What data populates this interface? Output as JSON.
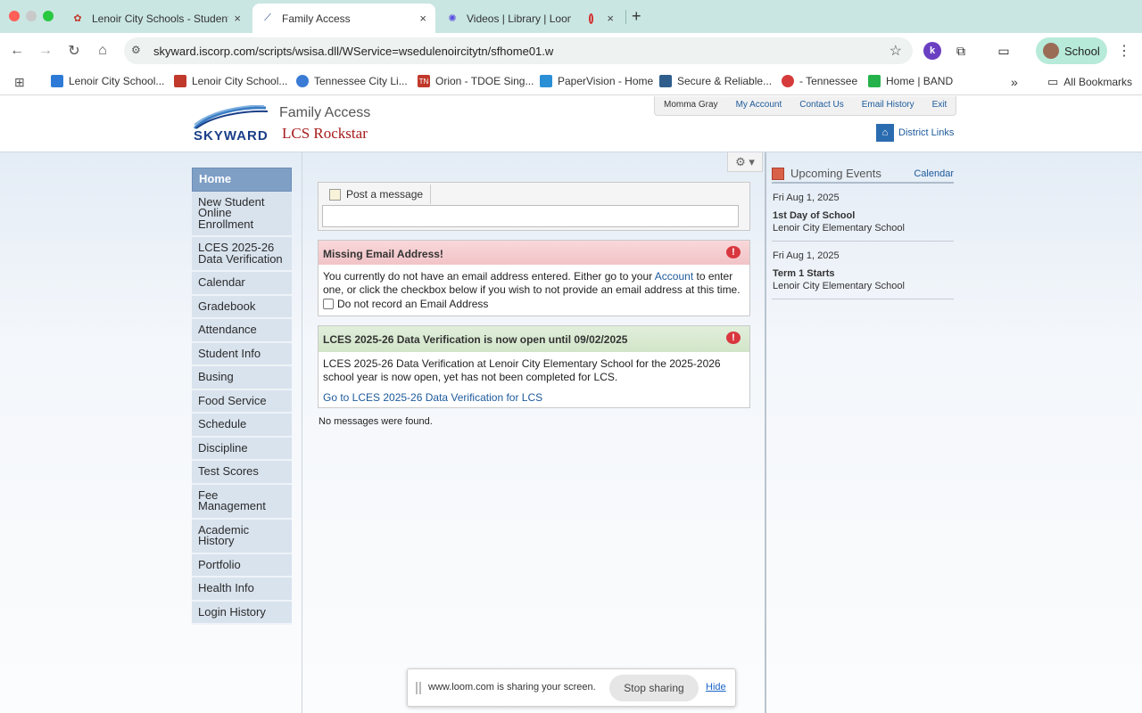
{
  "browser": {
    "tabs": [
      {
        "label": "Lenoir City Schools - Student",
        "active": false,
        "icon": "school-favicon-icon"
      },
      {
        "label": "Family Access",
        "active": true,
        "icon": "skyward-favicon-icon"
      },
      {
        "label": "Videos | Library | Loom",
        "active": false,
        "icon": "loom-favicon-icon"
      }
    ],
    "close_glyph": "×",
    "url": "skyward.iscorp.com/scripts/wsisa.dll/WService=wsedulenoircitytn/sfhome01.w",
    "profile_label": "School",
    "bookmarks": [
      {
        "label": "Lenoir City School...",
        "color": "#2d7bd6"
      },
      {
        "label": "Lenoir City School...",
        "color": "#c0392b"
      },
      {
        "label": "Tennessee City Li...",
        "color": "#3a7bd5"
      },
      {
        "label": "Orion - TDOE Sing...",
        "color": "#c0392b"
      },
      {
        "label": "PaperVision - Home",
        "color": "#2b8fd6"
      },
      {
        "label": "Secure & Reliable...",
        "color": "#2f5e8c"
      },
      {
        "label": "- Tennessee",
        "color": "#d63b3b"
      },
      {
        "label": "Home | BAND",
        "color": "#26b24b"
      }
    ],
    "all_bookmarks_label": "All Bookmarks"
  },
  "header": {
    "logo_word": "SKYWARD",
    "app_title": "Family Access",
    "app_subtitle": "LCS Rockstar",
    "top_nav": [
      "Momma Gray",
      "My Account",
      "Contact Us",
      "Email History",
      "Exit"
    ],
    "district_links": "District Links"
  },
  "sidebar": {
    "items": [
      "Home",
      "New Student Online Enrollment",
      "LCES 2025-26 Data Verification",
      "Calendar",
      "Gradebook",
      "Attendance",
      "Student Info",
      "Busing",
      "Food Service",
      "Schedule",
      "Discipline",
      "Test Scores",
      "Fee Management",
      "Academic History",
      "Portfolio",
      "Health Info",
      "Login History"
    ]
  },
  "main": {
    "post_tab": "Post a message",
    "email_msg": {
      "title": "Missing Email Address!",
      "body_pre": "You currently do not have an email address entered. Either go to your ",
      "body_link": "Account",
      "body_post": " to enter one, or click the checkbox below if you wish to not provide an email address at this time.",
      "checkbox_label": "Do not record an Email Address"
    },
    "verify_msg": {
      "title": "LCES 2025-26 Data Verification is now open until 09/02/2025",
      "body": "LCES 2025-26 Data Verification at Lenoir City Elementary School for the 2025-2026 school year is now open, yet has not been completed for LCS.",
      "link": "Go to LCES 2025-26 Data Verification for LCS"
    },
    "no_messages": "No messages were found.",
    "alert_glyph": "!"
  },
  "events": {
    "title": "Upcoming Events",
    "calendar_link": "Calendar",
    "items": [
      {
        "date": "Fri Aug 1, 2025",
        "name": "1st Day of School",
        "location": "Lenoir City Elementary School"
      },
      {
        "date": "Fri Aug 1, 2025",
        "name": "Term 1 Starts",
        "location": "Lenoir City Elementary School"
      }
    ]
  },
  "loom_bar": {
    "text": "www.loom.com is sharing your screen.",
    "stop_label": "Stop sharing",
    "hide_label": "Hide"
  }
}
